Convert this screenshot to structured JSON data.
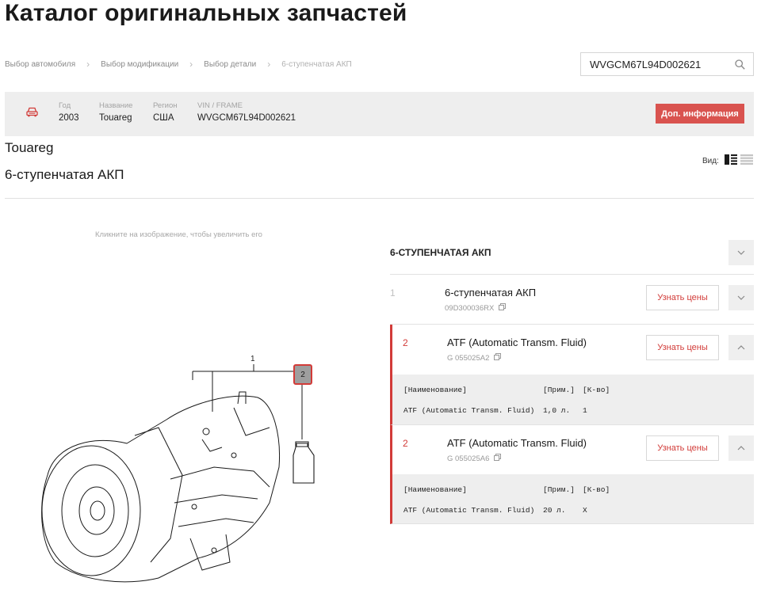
{
  "title": "Каталог оригинальных запчастей",
  "breadcrumb": [
    "Выбор автомобиля",
    "Выбор модификации",
    "Выбор детали",
    "6-ступенчатая АКП"
  ],
  "search": {
    "value": "WVGCM67L94D002621"
  },
  "vehicle": {
    "year_label": "Год",
    "year": "2003",
    "name_label": "Название",
    "name": "Touareg",
    "region_label": "Регион",
    "region": "США",
    "vin_label": "VIN / FRAME",
    "vin": "WVGCM67L94D002621",
    "more_button": "Доп. информация"
  },
  "model": "Touareg",
  "section": "6-ступенчатая АКП",
  "view_label": "Вид:",
  "diagram": {
    "hint": "Кликните на изображение, чтобы увеличить его",
    "callout_1": "1",
    "callout_2": "2"
  },
  "parts": {
    "group_title": "6-СТУПЕНЧАТАЯ АКП",
    "price_label": "Узнать цены",
    "items": [
      {
        "num": "1",
        "name": "6-ступенчатая АКП",
        "code": "09D300036RX"
      },
      {
        "num": "2",
        "name": "ATF (Automatic Transm. Fluid)",
        "code": "G 055025A2",
        "spec_header": {
          "name": "[Наименование]",
          "prim": "[Прим.]",
          "qty": "[К-во]"
        },
        "spec_row": {
          "name": "ATF (Automatic Transm. Fluid)",
          "prim": "1,0 л.",
          "qty": "1"
        }
      },
      {
        "num": "2",
        "name": "ATF (Automatic Transm. Fluid)",
        "code": "G 055025A6",
        "spec_header": {
          "name": "[Наименование]",
          "prim": "[Прим.]",
          "qty": "[К-во]"
        },
        "spec_row": {
          "name": "ATF (Automatic Transm. Fluid)",
          "prim": "20 л.",
          "qty": "X"
        }
      }
    ]
  },
  "colors": {
    "accent": "#d23b38",
    "button": "#d9534f",
    "panel": "#eeeeee"
  },
  "icons": {
    "search": "search-icon",
    "car": "car-icon",
    "copy": "copy-icon",
    "chevron_down": "chevron-down-icon",
    "chevron_up": "chevron-up-icon",
    "grid_view": "grid-view-icon",
    "list_view": "list-view-icon"
  }
}
